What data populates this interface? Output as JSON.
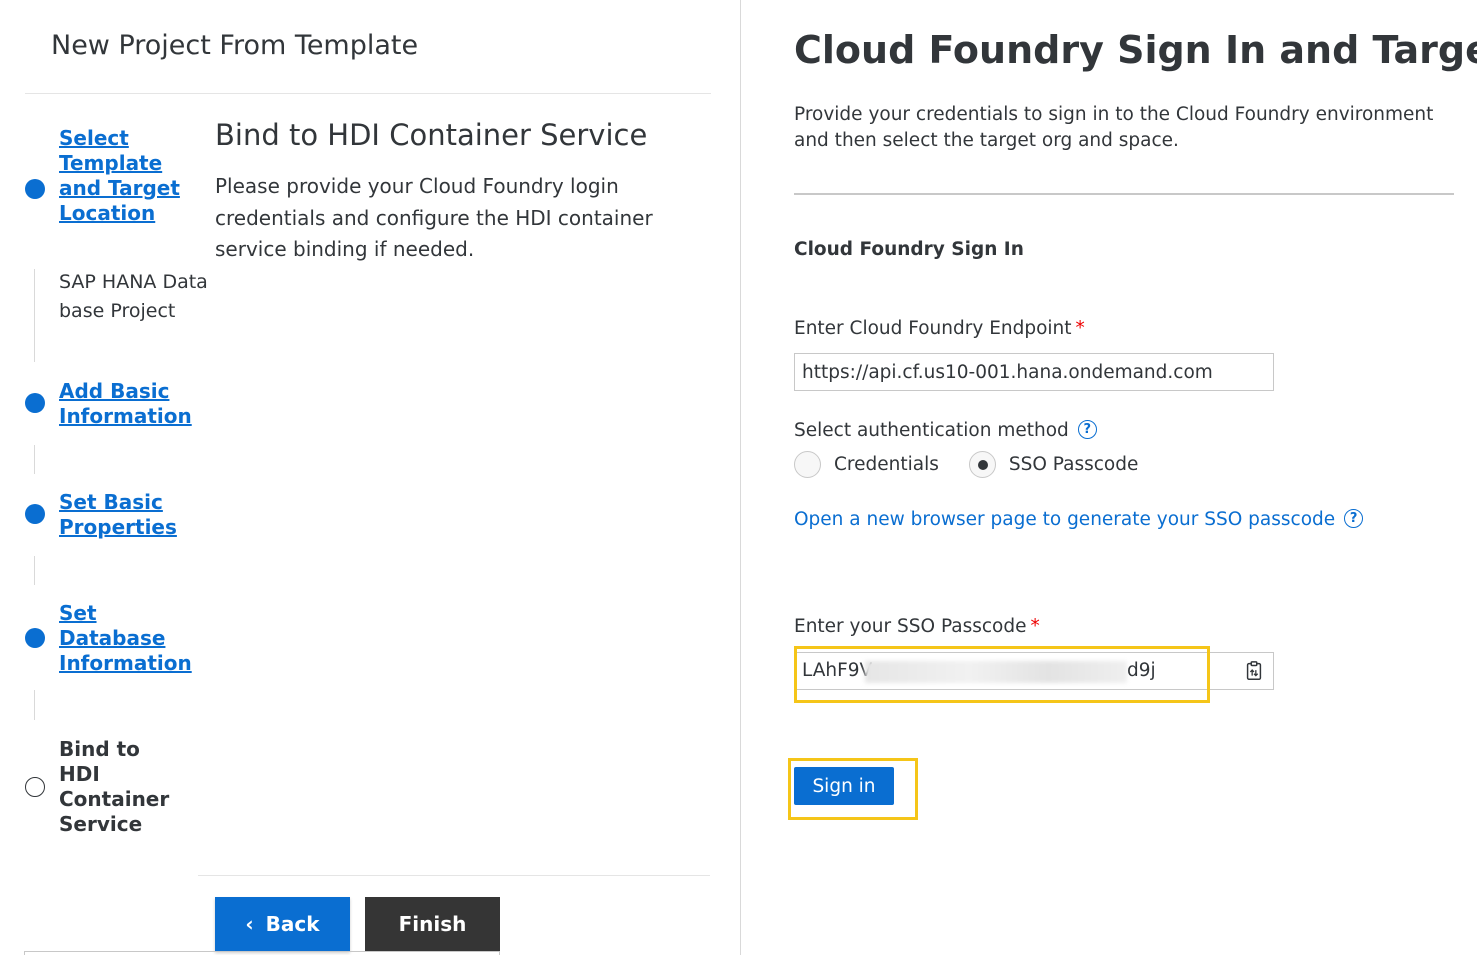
{
  "wizard": {
    "title": "New Project From Template",
    "steps": [
      {
        "label": "Select Template and Target Location",
        "sub": "SAP HANA Data base Project",
        "state": "done"
      },
      {
        "label": "Add Basic Information",
        "state": "done"
      },
      {
        "label": "Set Basic Properties",
        "state": "done"
      },
      {
        "label": "Set Database Information",
        "state": "done"
      },
      {
        "label": "Bind to HDI Container Service",
        "state": "current"
      }
    ],
    "current_step": {
      "title": "Bind to HDI Container Service",
      "description": "Please provide your Cloud Foundry login credentials and configure the HDI container service binding if needed."
    },
    "back_label": "Back",
    "finish_label": "Finish"
  },
  "cf": {
    "title": "Cloud Foundry Sign In and Targets",
    "description": "Provide your credentials to sign in to the Cloud Foundry environment and then select the target org and space.",
    "section_title": "Cloud Foundry Sign In",
    "endpoint_label": "Enter Cloud Foundry Endpoint",
    "endpoint_value": "https://api.cf.us10-001.hana.ondemand.com",
    "auth_label": "Select authentication method",
    "auth_options": [
      {
        "label": "Credentials",
        "selected": false
      },
      {
        "label": "SSO Passcode",
        "selected": true
      }
    ],
    "sso_link": "Open a new browser page to generate your SSO passcode",
    "passcode_label": "Enter your SSO Passcode",
    "passcode_start": "LAhF9V",
    "passcode_end": "d9j",
    "required_mark": "*",
    "signin_label": "Sign in"
  },
  "colors": {
    "accent": "#0a6ed1",
    "highlight": "#f5c518",
    "finish_bg": "#353535",
    "required": "#ee0000"
  }
}
